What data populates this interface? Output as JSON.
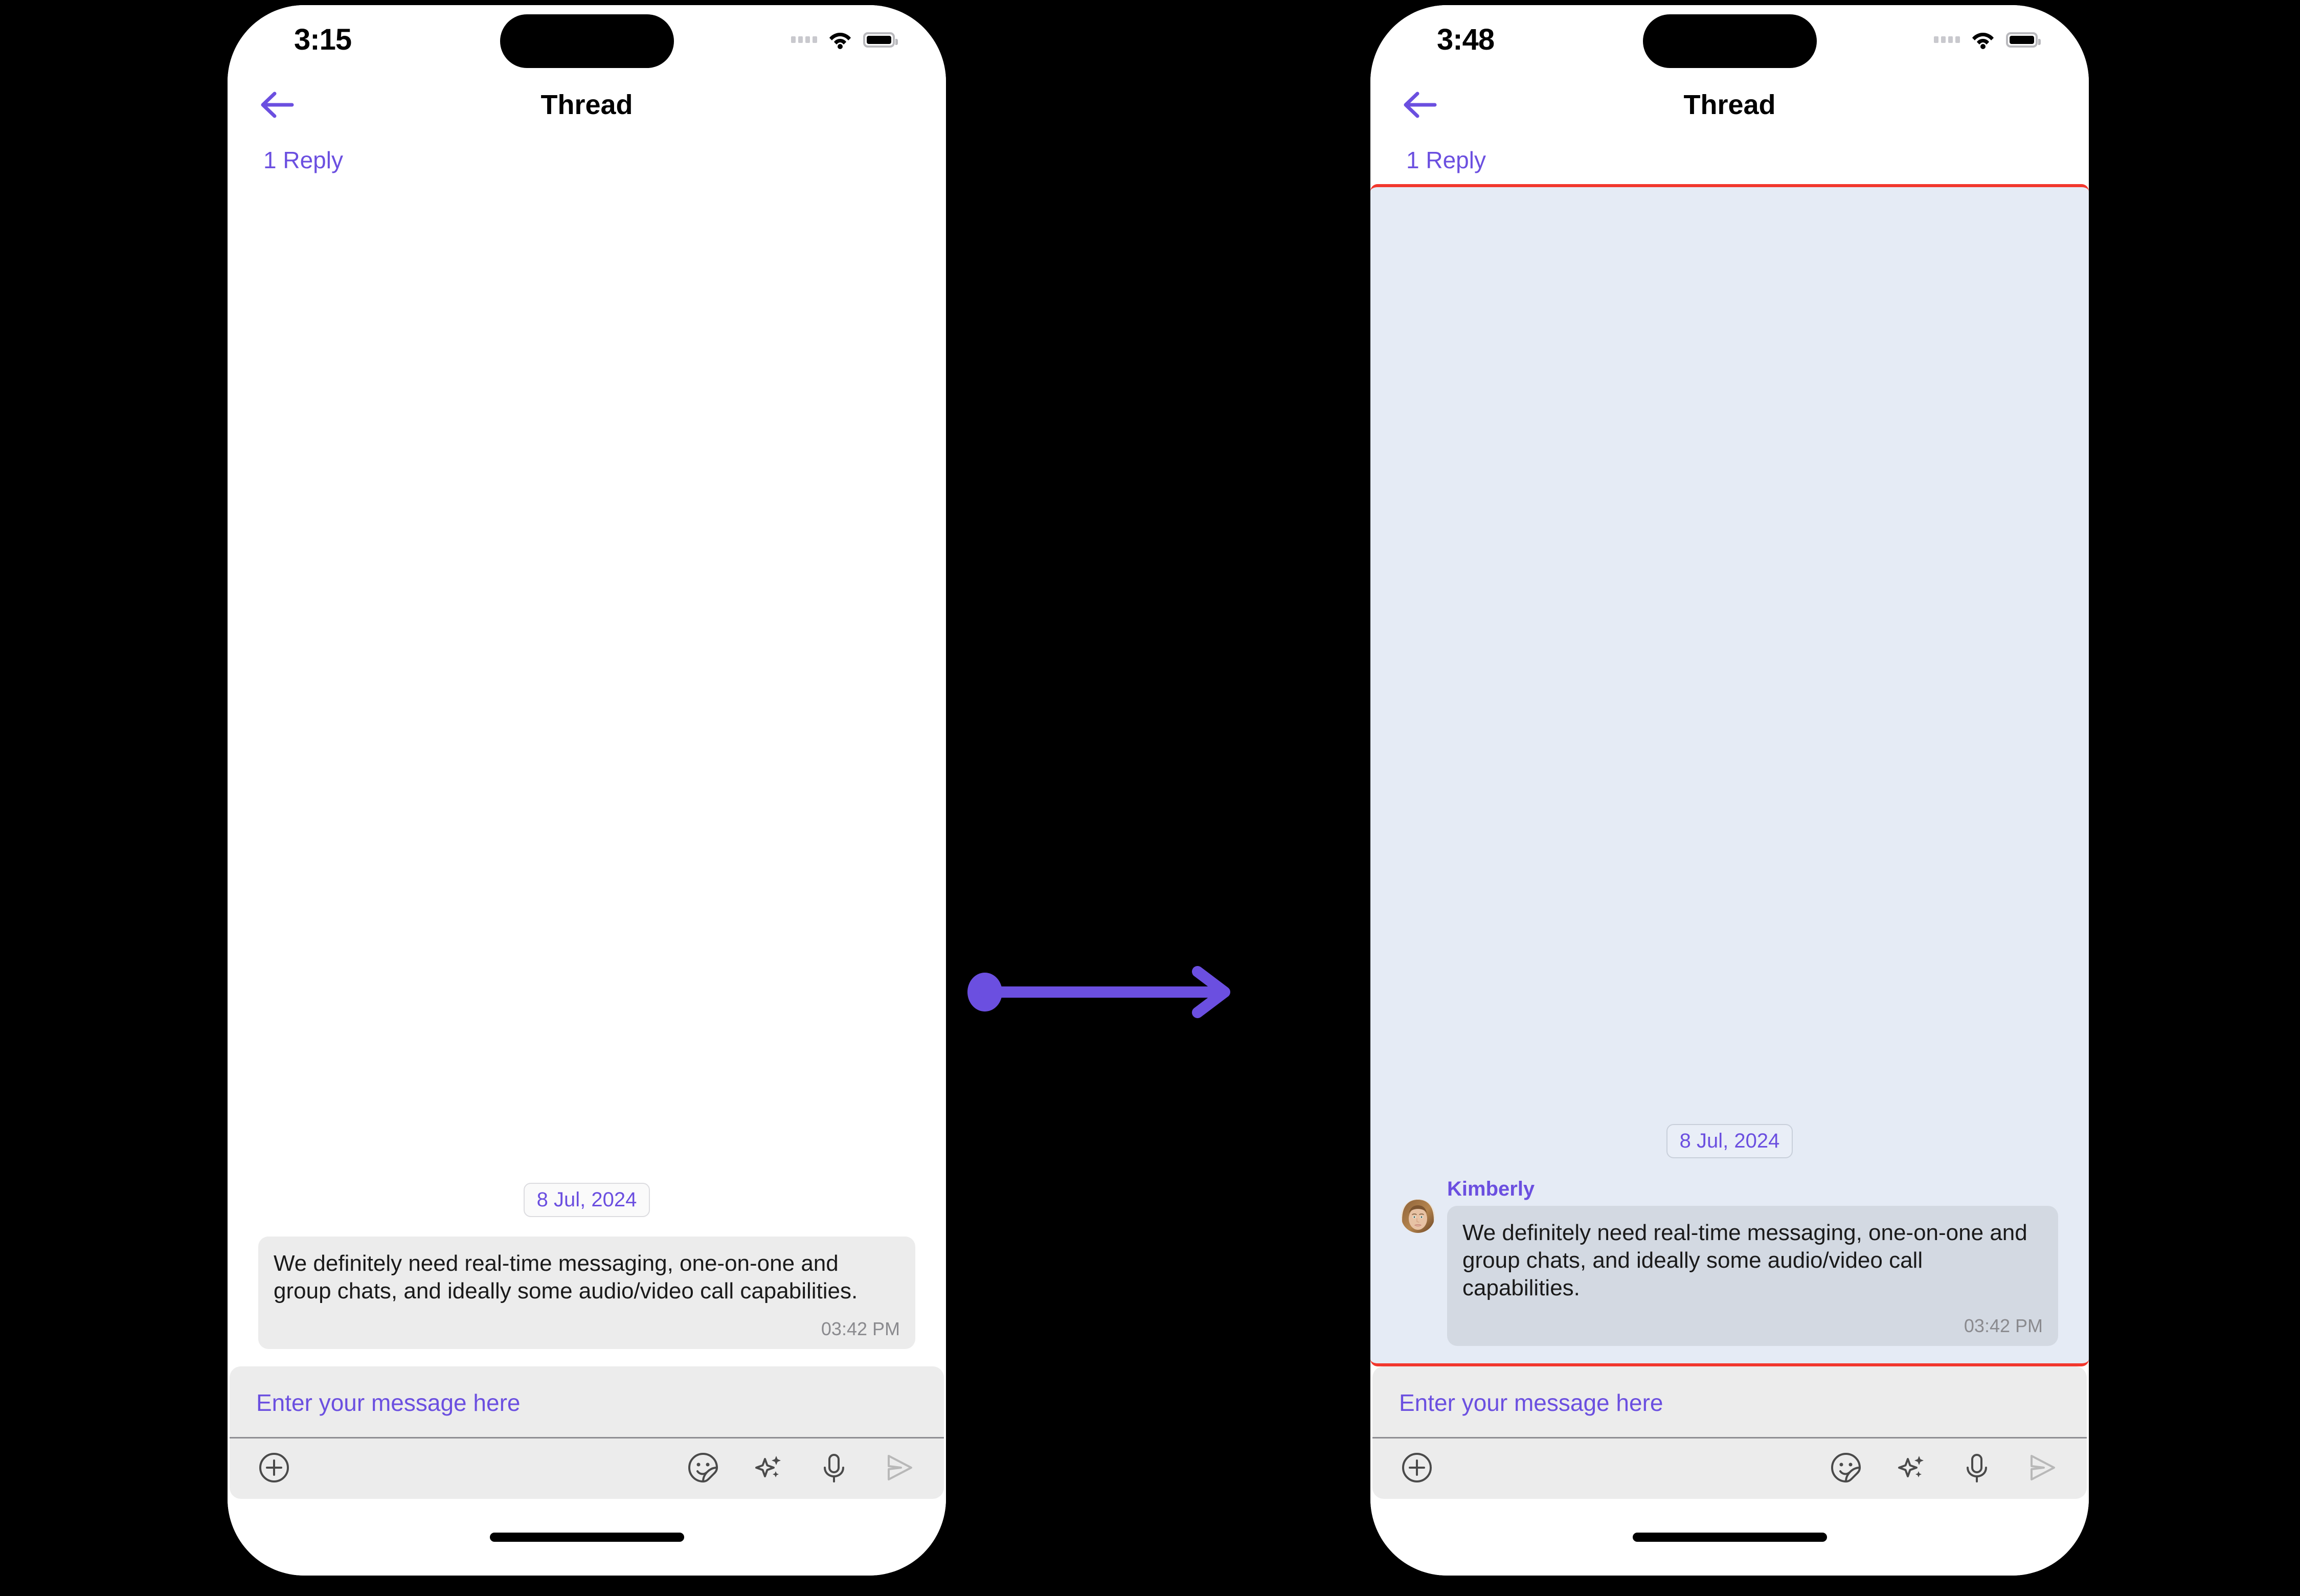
{
  "colors": {
    "accent_purple": "#6b4fe0",
    "highlight_border_red": "#f2372d",
    "highlight_bg": "#e5ebf5",
    "bubble_gray": "#ececec",
    "bubble_highlight_gray": "#d3d9e2",
    "composer_bg": "#ececec",
    "phone_bg": "#ffffff",
    "canvas_bg": "#000000"
  },
  "connector": {
    "name": "transition-arrow",
    "direction": "left-to-right"
  },
  "screens": [
    {
      "id": "before",
      "status_bar": {
        "time": "3:15",
        "signal_icon": "signal-dots-icon",
        "wifi_icon": "wifi-icon",
        "battery_icon": "battery-icon"
      },
      "nav": {
        "back_icon": "back-arrow-icon",
        "title": "Thread"
      },
      "reply_count": "1 Reply",
      "highlighted": false,
      "date_divider": "8 Jul, 2024",
      "message": {
        "sender": "",
        "show_avatar": false,
        "avatar_icon": "",
        "text": "We definitely need real-time messaging, one-on-one and group chats, and ideally some audio/video call capabilities.",
        "time": "03:42 PM"
      },
      "composer": {
        "placeholder": "Enter your message here",
        "value": "",
        "tools": [
          {
            "icon": "plus-circle-icon",
            "label": "Add attachment"
          },
          {
            "icon": "sticker-icon",
            "label": "Stickers"
          },
          {
            "icon": "sparkles-icon",
            "label": "AI assist"
          },
          {
            "icon": "microphone-icon",
            "label": "Voice message"
          },
          {
            "icon": "send-icon",
            "label": "Send"
          }
        ]
      }
    },
    {
      "id": "after",
      "status_bar": {
        "time": "3:48",
        "signal_icon": "signal-dots-icon",
        "wifi_icon": "wifi-icon",
        "battery_icon": "battery-icon"
      },
      "nav": {
        "back_icon": "back-arrow-icon",
        "title": "Thread"
      },
      "reply_count": "1 Reply",
      "highlighted": true,
      "date_divider": "8 Jul, 2024",
      "message": {
        "sender": "Kimberly",
        "show_avatar": true,
        "avatar_icon": "user-photo-avatar",
        "text": "We definitely need real-time messaging, one-on-one and group chats, and ideally some audio/video call capabilities.",
        "time": "03:42 PM"
      },
      "composer": {
        "placeholder": "Enter your message here",
        "value": "",
        "tools": [
          {
            "icon": "plus-circle-icon",
            "label": "Add attachment"
          },
          {
            "icon": "sticker-icon",
            "label": "Stickers"
          },
          {
            "icon": "sparkles-icon",
            "label": "AI assist"
          },
          {
            "icon": "microphone-icon",
            "label": "Voice message"
          },
          {
            "icon": "send-icon",
            "label": "Send"
          }
        ]
      }
    }
  ]
}
